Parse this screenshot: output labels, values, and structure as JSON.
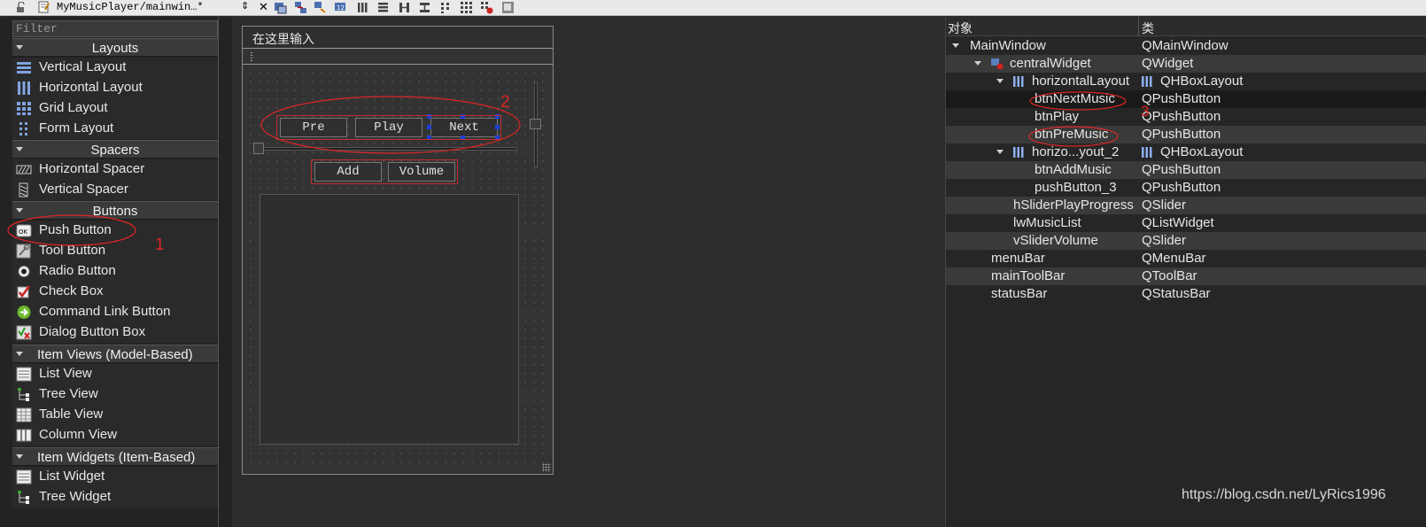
{
  "toolbar": {
    "file_title": "MyMusicPlayer/mainwin…*",
    "updown_glyph": "⇕",
    "close_glyph": "✕"
  },
  "widget_box": {
    "filter_placeholder": "Filter",
    "categories": {
      "layouts": "Layouts",
      "spacers": "Spacers",
      "buttons": "Buttons",
      "item_views": "Item Views (Model-Based)",
      "item_widgets": "Item Widgets (Item-Based)"
    },
    "items": {
      "vertical_layout": "Vertical Layout",
      "horizontal_layout": "Horizontal Layout",
      "grid_layout": "Grid Layout",
      "form_layout": "Form Layout",
      "horizontal_spacer": "Horizontal Spacer",
      "vertical_spacer": "Vertical Spacer",
      "push_button": "Push Button",
      "tool_button": "Tool Button",
      "radio_button": "Radio Button",
      "check_box": "Check Box",
      "command_link_button": "Command Link Button",
      "dialog_button_box": "Dialog Button Box",
      "list_view": "List View",
      "tree_view": "Tree View",
      "table_view": "Table View",
      "column_view": "Column View",
      "list_widget": "List Widget",
      "tree_widget": "Tree Widget"
    },
    "push_button_icon_text": "OK"
  },
  "form": {
    "menu_placeholder": "在这里输入",
    "buttons": {
      "pre": "Pre",
      "play": "Play",
      "next": "Next",
      "add": "Add",
      "volume": "Volume"
    }
  },
  "inspector": {
    "header_object": "对象",
    "header_class": "类",
    "rows": {
      "mainwindow": {
        "name": "MainWindow",
        "cls": "QMainWindow"
      },
      "centralwidget": {
        "name": "centralWidget",
        "cls": "QWidget"
      },
      "horizontallayout": {
        "name": "horizontalLayout",
        "cls": "QHBoxLayout"
      },
      "btnnextmusic": {
        "name": "btnNextMusic",
        "cls": "QPushButton"
      },
      "btnplay": {
        "name": "btnPlay",
        "cls": "QPushButton"
      },
      "btnpremusic": {
        "name": "btnPreMusic",
        "cls": "QPushButton"
      },
      "horizontallayout2": {
        "name": "horizo...yout_2",
        "cls": "QHBoxLayout"
      },
      "btnaddmusic": {
        "name": "btnAddMusic",
        "cls": "QPushButton"
      },
      "pushbutton3": {
        "name": "pushButton_3",
        "cls": "QPushButton"
      },
      "hsliderplayprogress": {
        "name": "hSliderPlayProgress",
        "cls": "QSlider"
      },
      "lwmusiclist": {
        "name": "lwMusicList",
        "cls": "QListWidget"
      },
      "vslidervolume": {
        "name": "vSliderVolume",
        "cls": "QSlider"
      },
      "menubar": {
        "name": "menuBar",
        "cls": "QMenuBar"
      },
      "maintoolbar": {
        "name": "mainToolBar",
        "cls": "QToolBar"
      },
      "statusbar": {
        "name": "statusBar",
        "cls": "QStatusBar"
      }
    }
  },
  "annotations": {
    "n1": "1",
    "n2": "2",
    "n3": "3",
    "color": "#e02525"
  },
  "watermark": "https://blog.csdn.net/LyRics1996",
  "icons": {
    "lock": "lock-icon",
    "edit": "edit-icon",
    "toolbar": [
      "widget-edit-icon",
      "signal-slot-icon",
      "buddy-icon",
      "tab-order-icon",
      "hlayout-icon",
      "vlayout-icon",
      "hsplitter-icon",
      "vsplitter-icon",
      "form-layout-icon",
      "grid-layout-icon",
      "break-layout-icon",
      "adjust-size-icon"
    ]
  }
}
